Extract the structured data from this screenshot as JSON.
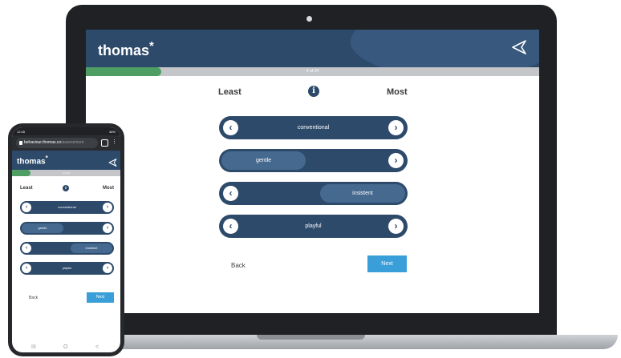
{
  "desktop": {
    "brand": {
      "name": "thomas",
      "mark": "*"
    },
    "progress": {
      "label": "4 of 24",
      "fraction": 0.167
    },
    "scale": {
      "least": "Least",
      "most": "Most",
      "info": "i"
    },
    "items": [
      {
        "label": "conventional",
        "position": "center"
      },
      {
        "label": "gentle",
        "position": "left"
      },
      {
        "label": "insistent",
        "position": "right"
      },
      {
        "label": "playful",
        "position": "center"
      }
    ],
    "nav": {
      "back": "Back",
      "next": "Next"
    }
  },
  "mobile": {
    "status": {
      "time": "12:45",
      "battery": "46%"
    },
    "url": {
      "host": "behaviour.thomas.co",
      "path": "/assessment"
    },
    "brand": {
      "name": "thomas",
      "mark": "*"
    },
    "progress": {
      "label": "4 of 24",
      "fraction": 0.167
    },
    "scale": {
      "least": "Least",
      "most": "Most",
      "info": "i"
    },
    "items": [
      {
        "label": "conventional",
        "position": "center"
      },
      {
        "label": "gentle",
        "position": "left"
      },
      {
        "label": "insistent",
        "position": "right"
      },
      {
        "label": "playful",
        "position": "center"
      }
    ],
    "nav": {
      "back": "Back",
      "next": "Next"
    },
    "system_nav": {
      "recents": "III",
      "home": "O",
      "back": "<"
    }
  },
  "colors": {
    "navy": "#2d4a6b",
    "green": "#4e9e63",
    "blue": "#3a9fd8"
  }
}
